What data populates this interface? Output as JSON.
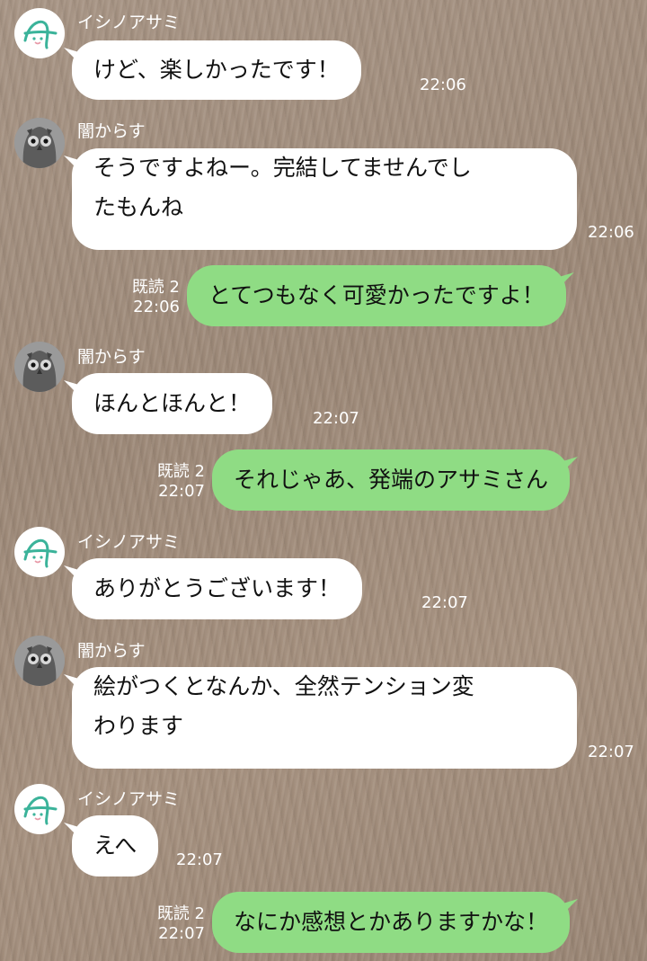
{
  "contacts": {
    "ishino": "イシノアサミ",
    "yami": "闇からす"
  },
  "messages": [
    {
      "id": 1,
      "sender": "イシノアサミ",
      "side": "in",
      "text": "けど、楽しかったです！",
      "time": "22:06"
    },
    {
      "id": 2,
      "sender": "闇からす",
      "side": "in",
      "lines": [
        "そうですよねー。完結してませんでし",
        "たもんね"
      ],
      "time": "22:06"
    },
    {
      "id": 3,
      "side": "out",
      "read": "既読 2",
      "text": "とてつもなく可愛かったですよ！",
      "time": "22:06"
    },
    {
      "id": 4,
      "sender": "闇からす",
      "side": "in",
      "text": "ほんとほんと！",
      "time": "22:07"
    },
    {
      "id": 5,
      "side": "out",
      "read": "既読 2",
      "text": "それじゃあ、発端のアサミさん",
      "time": "22:07"
    },
    {
      "id": 6,
      "sender": "イシノアサミ",
      "side": "in",
      "text": "ありがとうございます！",
      "time": "22:07"
    },
    {
      "id": 7,
      "sender": "闇からす",
      "side": "in",
      "lines": [
        "絵がつくとなんか、全然テンション変",
        "わります"
      ],
      "time": "22:07"
    },
    {
      "id": 8,
      "sender": "イシノアサミ",
      "side": "in",
      "text": "えへ",
      "time": "22:07"
    },
    {
      "id": 9,
      "side": "out",
      "read": "既読 2",
      "text": "なにか感想とかありますかな！",
      "time": "22:07"
    }
  ],
  "colors": {
    "incoming_bubble": "#ffffff",
    "outgoing_bubble": "#8fdc84",
    "meta_text": "#ffffff",
    "avatar_logo": "#3bb39a"
  },
  "icons": {
    "ishino_avatar": "a-logo-icon",
    "yami_avatar": "owl-icon"
  }
}
